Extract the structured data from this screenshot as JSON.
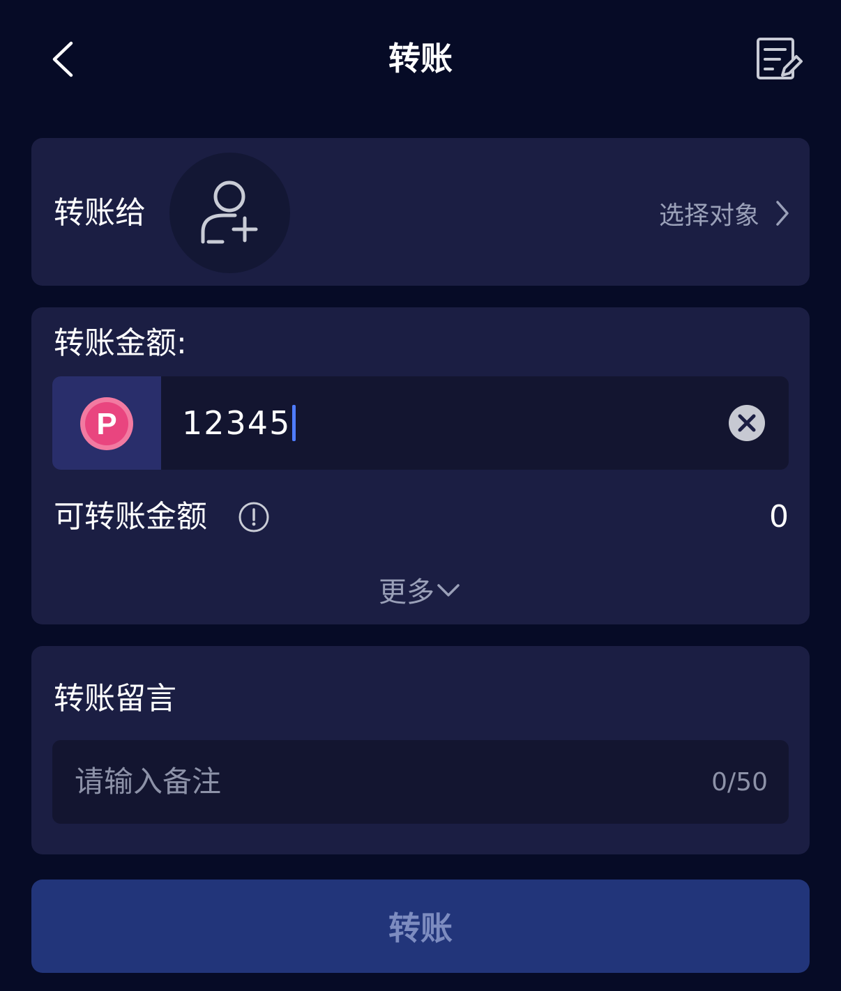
{
  "header": {
    "title": "转账",
    "back_icon": "chevron-left-icon",
    "record_icon": "edit-document-icon"
  },
  "recipient": {
    "label": "转账给",
    "avatar_icon": "add-user-icon",
    "select_label": "选择对象"
  },
  "amount": {
    "label": "转账金额:",
    "token_icon": "p-coin-icon",
    "value": "12345",
    "available_label": "可转账金额",
    "available_value": "0",
    "more_label": "更多"
  },
  "message": {
    "label": "转账留言",
    "placeholder": "请输入备注",
    "counter": "0/50"
  },
  "submit": {
    "label": "转账"
  },
  "colors": {
    "background": "#060b26",
    "card": "#1b1e43",
    "input": "#131530",
    "button": "#22357a",
    "accent": "#4f7cff",
    "coin": "#e9457f"
  }
}
